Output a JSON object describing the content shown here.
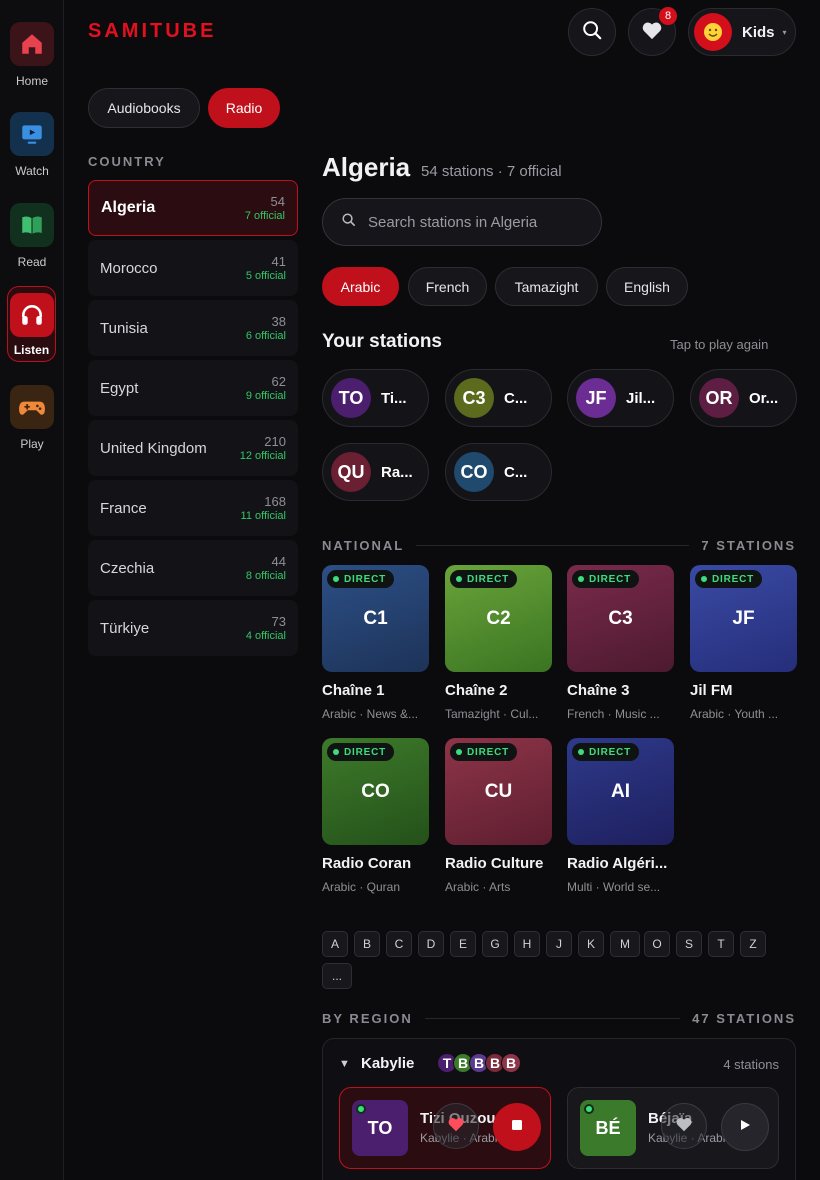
{
  "nav": {
    "items": [
      {
        "label": "Home",
        "icon": "house-icon",
        "active": false
      },
      {
        "label": "Watch",
        "icon": "tv-icon",
        "active": false
      },
      {
        "label": "Read",
        "icon": "book-icon",
        "active": false
      },
      {
        "label": "Listen",
        "icon": "headphones-icon",
        "active": true
      },
      {
        "label": "Play",
        "icon": "gamepad-icon",
        "active": false
      }
    ]
  },
  "header": {
    "brand": "SAMITUBE",
    "favorites_badge": "8",
    "profile_name": "Kids",
    "profile_avatar": "smiley-icon"
  },
  "tabs": [
    {
      "label": "Audiobooks",
      "active": false
    },
    {
      "label": "Radio",
      "active": true
    }
  ],
  "country_caption": "COUNTRY",
  "countries": [
    {
      "name": "Algeria",
      "count": "54",
      "official": "7 official",
      "active": true
    },
    {
      "name": "Morocco",
      "count": "41",
      "official": "5 official"
    },
    {
      "name": "Tunisia",
      "count": "38",
      "official": "6 official"
    },
    {
      "name": "Egypt",
      "count": "62",
      "official": "9 official"
    },
    {
      "name": "United Kingdom",
      "count": "210",
      "official": "12 official"
    },
    {
      "name": "France",
      "count": "168",
      "official": "11 official"
    },
    {
      "name": "Czechia",
      "count": "44",
      "official": "8 official"
    },
    {
      "name": "Türkiye",
      "count": "73",
      "official": "4 official"
    }
  ],
  "main": {
    "title": "Algeria",
    "meta": "54 stations · 7 official",
    "search_placeholder": "Search stations in Algeria",
    "languages": [
      {
        "label": "Arabic",
        "active": true
      },
      {
        "label": "French"
      },
      {
        "label": "Tamazight"
      },
      {
        "label": "English"
      }
    ],
    "your_stations_title": "Your stations",
    "tap_hint": "Tap to play again",
    "your_stations": [
      {
        "initials": "TO",
        "name": "Ti...",
        "color": "#4b1f6e"
      },
      {
        "initials": "C3",
        "name": "C...",
        "color": "#5b6a1d"
      },
      {
        "initials": "JF",
        "name": "Jil...",
        "color": "#6b2c94"
      },
      {
        "initials": "OR",
        "name": "Or...",
        "color": "#5e1e43"
      },
      {
        "initials": "QU",
        "name": "Ra...",
        "color": "#6a1f33"
      },
      {
        "initials": "CO",
        "name": "C...",
        "color": "#1f4a6e"
      }
    ],
    "national": {
      "caption": "NATIONAL",
      "count": "7 STATIONS",
      "direct_label": "DIRECT",
      "stations": [
        {
          "initials": "C1",
          "name": "Chaîne 1",
          "sub": "Arabic · News &...",
          "color_a": "#2c4f86",
          "color_b": "#1d3358"
        },
        {
          "initials": "C2",
          "name": "Chaîne 2",
          "sub": "Tamazight · Cul...",
          "color_a": "#6aa43a",
          "color_b": "#3a7422"
        },
        {
          "initials": "C3",
          "name": "Chaîne 3",
          "sub": "French · Music ...",
          "color_a": "#7a2a4b",
          "color_b": "#4c1a2f"
        },
        {
          "initials": "JF",
          "name": "Jil FM",
          "sub": "Arabic · Youth ...",
          "color_a": "#3a4aa4",
          "color_b": "#252e7a"
        },
        {
          "initials": "CO",
          "name": "Radio Coran",
          "sub": "Arabic · Quran",
          "color_a": "#3d7a2a",
          "color_b": "#24511a"
        },
        {
          "initials": "CU",
          "name": "Radio Culture",
          "sub": "Arabic · Arts",
          "color_a": "#8e3448",
          "color_b": "#5e1e30"
        },
        {
          "initials": "AI",
          "name": "Radio Algéri...",
          "sub": "Multi · World se...",
          "color_a": "#2e3a8a",
          "color_b": "#1e1f5e"
        }
      ]
    },
    "alphabet": [
      "A",
      "B",
      "C",
      "D",
      "E",
      "G",
      "H",
      "J",
      "K",
      "M",
      "O",
      "S",
      "T",
      "Z",
      "..."
    ],
    "by_region": {
      "caption": "BY REGION",
      "count": "47 STATIONS",
      "region": {
        "name": "Kabylie",
        "count": "4 stations",
        "avatars": [
          {
            "letter": "T",
            "color": "#4b1f6e"
          },
          {
            "letter": "B",
            "color": "#3a7a2a"
          },
          {
            "letter": "B",
            "color": "#5a3a8e"
          },
          {
            "letter": "B",
            "color": "#7a2a3a"
          },
          {
            "letter": "B",
            "color": "#8e3448"
          }
        ],
        "tiles": [
          {
            "initials": "TO",
            "name": "Tizi Ouzou",
            "sub": "Kabylie · Arabic",
            "color": "#4b1f6e",
            "playing": true
          },
          {
            "initials": "BÉ",
            "name": "Béjaïa",
            "sub": "Kabylie · Arabic",
            "color": "#3a7a2a",
            "playing": false
          }
        ]
      }
    }
  }
}
